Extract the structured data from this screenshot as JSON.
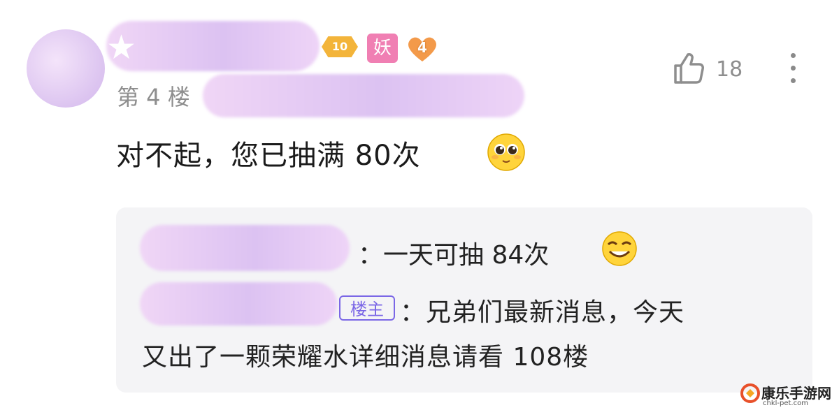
{
  "post": {
    "level": "10",
    "tag_demon": "妖",
    "heart_level": "4",
    "floor": "第 4 楼",
    "likes": "18",
    "content": "对不起，您已抽满 80次",
    "icons": [
      "like-icon",
      "more-icon",
      "smile-pleading-emoji",
      "grin-emoji"
    ]
  },
  "replies": [
    {
      "text": "：一天可抽 84次"
    },
    {
      "owner_tag": "楼主",
      "line1": "：兄弟们最新消息，今天",
      "line2": "又出了一颗荣耀水详细消息请看 108楼"
    }
  ],
  "watermark": {
    "name": "康乐手游网",
    "url": "chkl-pet.com"
  },
  "colors": {
    "accent_purple": "#7b67e6",
    "level_gold": "#f3b43a",
    "demon_pink": "#f07fb3",
    "gray_text": "#8e8e8e"
  }
}
